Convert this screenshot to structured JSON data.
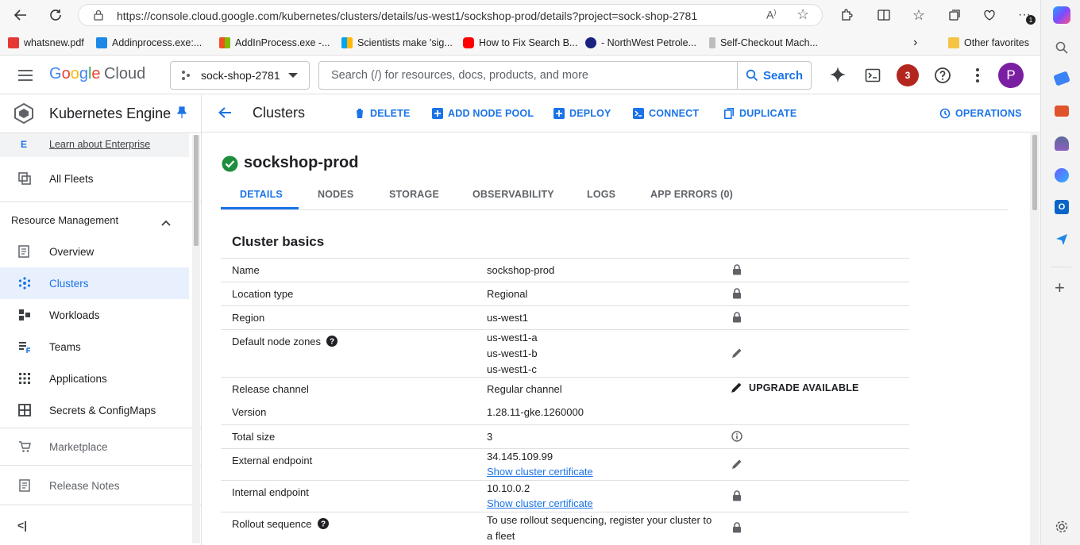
{
  "browser": {
    "url": "https://console.cloud.google.com/kubernetes/clusters/details/us-west1/sockshop-prod/details?project=sock-shop-2781",
    "bookmarks": [
      {
        "label": "whatsnew.pdf",
        "icon": "pdf-icon",
        "color": "#e53935"
      },
      {
        "label": "Addinprocess.exe:...",
        "icon": "w-icon",
        "color": "#1e88e5"
      },
      {
        "label": "AddInProcess.exe -...",
        "icon": "microsoft-icon",
        "color": "#f25022"
      },
      {
        "label": "Scientists make 'sig...",
        "icon": "microsoft-icon",
        "color": "#7fba00"
      },
      {
        "label": "How to Fix Search B...",
        "icon": "youtube-icon",
        "color": "#ff0000"
      },
      {
        "label": "- NorthWest Petrole...",
        "icon": "star-badge-icon",
        "color": "#1a237e"
      },
      {
        "label": "Self-Checkout Mach...",
        "icon": "leaf-icon",
        "color": "#9e9e9e"
      }
    ],
    "other_favorites": "Other favorites",
    "notification_count": "1"
  },
  "header": {
    "logo_google": "Google",
    "logo_cloud": "Cloud",
    "project": "sock-shop-2781",
    "search_placeholder": "Search (/) for resources, docs, products, and more",
    "search_button": "Search",
    "notifications_count": "3",
    "avatar_letter": "P"
  },
  "leftnav": {
    "product": "Kubernetes Engine",
    "enterprise_badge": "E",
    "enterprise_link": "Learn about Enterprise",
    "all_fleets": "All Fleets",
    "section": "Resource Management",
    "items": [
      {
        "label": "Overview",
        "icon": "overview-icon"
      },
      {
        "label": "Clusters",
        "icon": "clusters-icon",
        "active": true
      },
      {
        "label": "Workloads",
        "icon": "workloads-icon"
      },
      {
        "label": "Teams",
        "icon": "teams-icon"
      },
      {
        "label": "Applications",
        "icon": "applications-icon"
      },
      {
        "label": "Secrets & ConfigMaps",
        "icon": "secrets-icon"
      }
    ],
    "marketplace": "Marketplace",
    "release_notes": "Release Notes"
  },
  "toolbar": {
    "title": "Clusters",
    "delete": "DELETE",
    "add_node_pool": "ADD NODE POOL",
    "deploy": "DEPLOY",
    "connect": "CONNECT",
    "duplicate": "DUPLICATE",
    "operations": "OPERATIONS"
  },
  "cluster": {
    "name": "sockshop-prod",
    "tabs": [
      "DETAILS",
      "NODES",
      "STORAGE",
      "OBSERVABILITY",
      "LOGS",
      "APP ERRORS (0)"
    ],
    "active_tab": "DETAILS",
    "section_title": "Cluster basics",
    "rows": {
      "name": {
        "key": "Name",
        "value": "sockshop-prod"
      },
      "location_type": {
        "key": "Location type",
        "value": "Regional"
      },
      "region": {
        "key": "Region",
        "value": "us-west1"
      },
      "zones": {
        "key": "Default node zones",
        "values": [
          "us-west1-a",
          "us-west1-b",
          "us-west1-c"
        ]
      },
      "release_channel": {
        "key": "Release channel",
        "value": "Regular channel",
        "action": "UPGRADE AVAILABLE"
      },
      "version": {
        "key": "Version",
        "value": "1.28.11-gke.1260000"
      },
      "total_size": {
        "key": "Total size",
        "value": "3"
      },
      "external_endpoint": {
        "key": "External endpoint",
        "value": "34.145.109.99",
        "link": "Show cluster certificate"
      },
      "internal_endpoint": {
        "key": "Internal endpoint",
        "value": "10.10.0.2",
        "link": "Show cluster certificate"
      },
      "rollout_sequence": {
        "key": "Rollout sequence",
        "value_line1": "To use rollout sequencing, register your cluster to",
        "value_line2": "a fleet"
      }
    }
  },
  "colors": {
    "accent": "#1a73e8",
    "active_nav_bg": "#e8f0fe",
    "success": "#1e8e3e",
    "badge_red": "#b3261e",
    "avatar": "#7b1fa2"
  }
}
